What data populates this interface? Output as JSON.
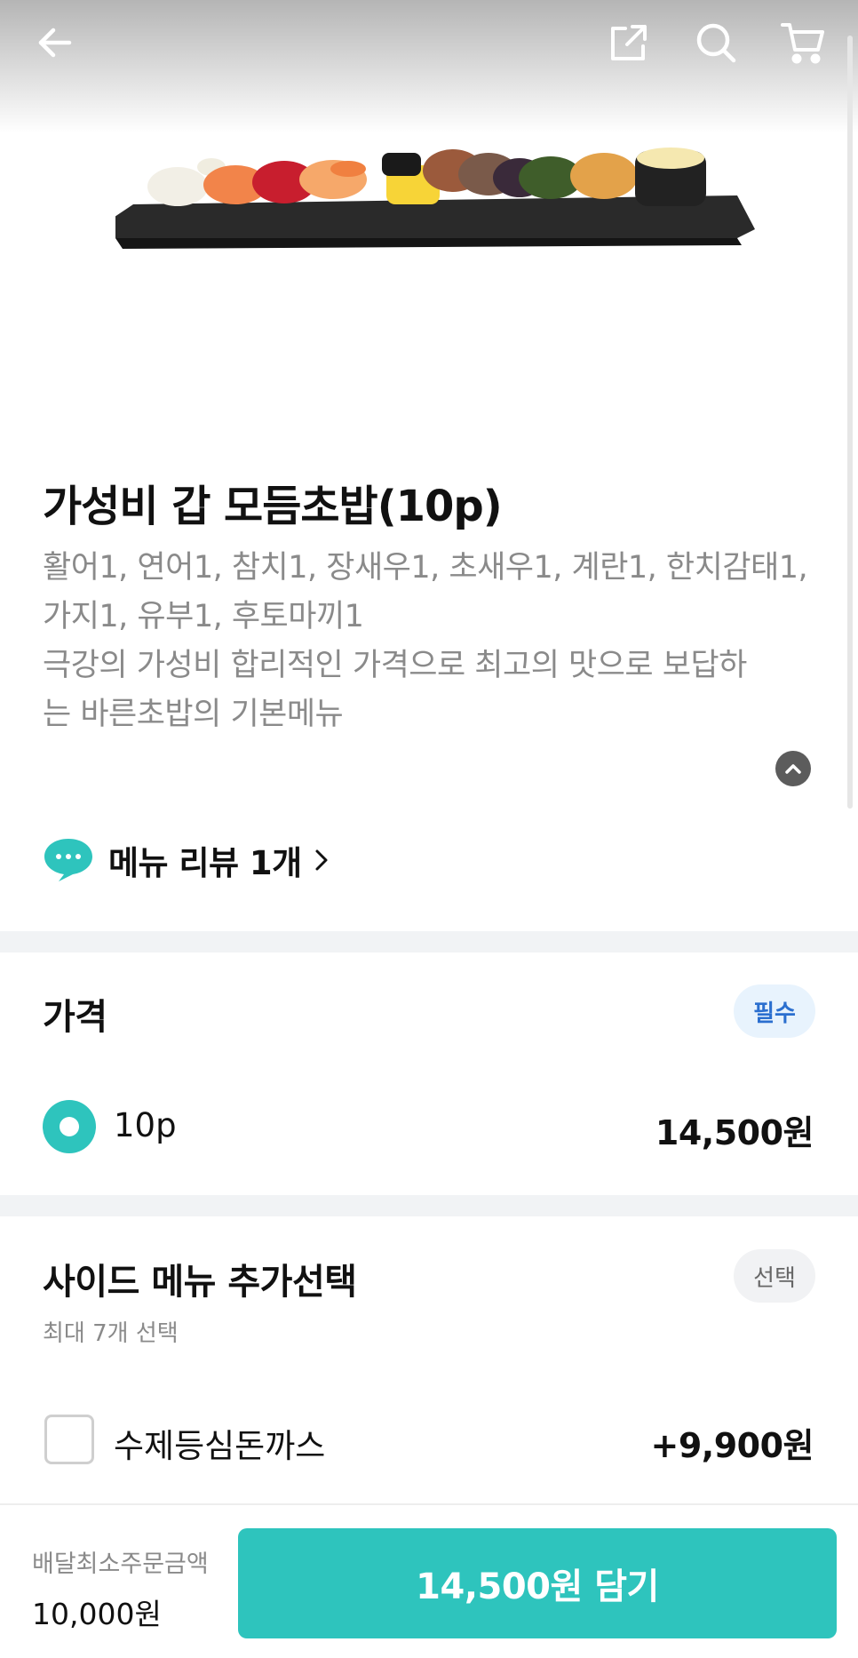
{
  "header": {
    "back_icon": "arrow-left-icon",
    "share_icon": "share-icon",
    "search_icon": "search-icon",
    "cart_icon": "cart-icon"
  },
  "menu": {
    "title": "가성비 갑 모듬초밥(10p)",
    "description_lines": [
      "활어1, 연어1, 참치1, 장새우1, 초새우1, 계란1, 한치감태1,",
      " 가지1, 유부1, 후토마끼1",
      "극강의 가성비 합리적인 가격으로 최고의 맛으로 보답하",
      "는 바른초밥의 기본메뉴"
    ],
    "review_label": "메뉴 리뷰 1개"
  },
  "price_section": {
    "title": "가격",
    "badge": "필수",
    "options": [
      {
        "label": "10p",
        "price": "14,500원",
        "selected": true
      }
    ]
  },
  "side_section": {
    "title": "사이드 메뉴 추가선택",
    "badge": "선택",
    "note": "최대 7개 선택",
    "options": [
      {
        "label": "수제등심돈까스",
        "price": "+9,900원",
        "checked": false
      }
    ]
  },
  "bottom": {
    "min_order_label": "배달최소주문금액",
    "min_order_value": "10,000원",
    "cta_label": "14,500원 담기"
  },
  "colors": {
    "accent": "#2ec4bd",
    "required_badge_text": "#2b6fcf",
    "required_badge_bg": "#e8f3fd",
    "muted_text": "#8a8a8a"
  }
}
